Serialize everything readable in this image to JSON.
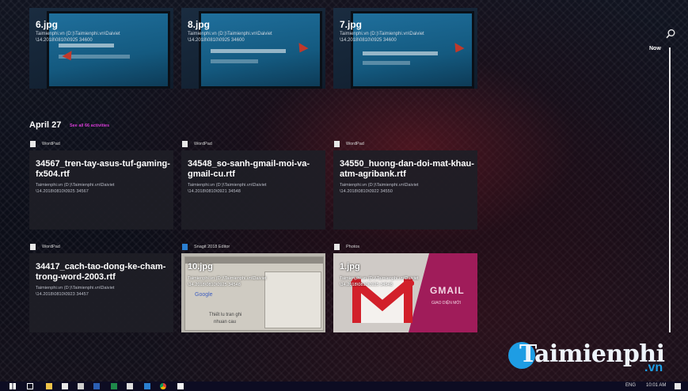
{
  "timeline_marker": "Now",
  "top_cards": [
    {
      "title": "6.jpg",
      "line1": "Taimienphi.vn (D:)\\Taimienphi.vn\\Daiviet",
      "line2": "\\14.2018\\0810\\0925 34600"
    },
    {
      "title": "8.jpg",
      "line1": "Taimienphi.vn (D:)\\Taimienphi.vn\\Daiviet",
      "line2": "\\14.2018\\0810\\0925 34600"
    },
    {
      "title": "7.jpg",
      "line1": "Taimienphi.vn (D:)\\Taimienphi.vn\\Daiviet",
      "line2": "\\14.2018\\0810\\0925 34600"
    }
  ],
  "section": {
    "date": "April 27",
    "see_all": "See all 66 activities"
  },
  "row1": [
    {
      "app": "WordPad",
      "title": "34567_tren-tay-asus-tuf-gaming-fx504.rtf",
      "line1": "Taimienphi.vn (D:)\\Taimienphi.vn\\Daiviet",
      "line2": "\\14.2018\\0810\\0925 34567"
    },
    {
      "app": "WordPad",
      "title": "34548_so-sanh-gmail-moi-va-gmail-cu.rtf",
      "line1": "Taimienphi.vn (D:)\\Taimienphi.vn\\Daiviet",
      "line2": "\\14.2018\\0810\\0921 34548"
    },
    {
      "app": "WordPad",
      "title": "34550_huong-dan-doi-mat-khau-atm-agribank.rtf",
      "line1": "Taimienphi.vn (D:)\\Taimienphi.vn\\Daiviet",
      "line2": "\\14.2018\\0810\\0922 34550"
    }
  ],
  "row2": [
    {
      "app": "WordPad",
      "title": "34417_cach-tao-dong-ke-cham-trong-word-2003.rtf",
      "line1": "Taimienphi.vn (D:)\\Taimienphi.vn\\Daiviet",
      "line2": "\\14.2018\\0810\\0923 34457"
    },
    {
      "app": "Snagit 2018 Editor",
      "title": "10.jpg",
      "line1": "Taimienphi.vn (D:)\\Taimienphi.vn\\Daiviet",
      "line2": "\\14.2018\\0810\\0925 34548",
      "thumb_text1": "Thiết lu tran ghi",
      "thumb_text2": "nhuan cau",
      "thumb_brand": "Google"
    },
    {
      "app": "Photos",
      "title": "1.jpg",
      "line1": "Taimienphi.vn (D:)\\Taimienphi.vn\\Daiviet",
      "line2": "\\14.2018\\0810\\0925 34548",
      "thumb_brand": "GMAIL",
      "thumb_sub": "GIAO DIỆN MỚI"
    }
  ],
  "watermark": {
    "brand": "Taimienphi",
    "tld": ".vn"
  },
  "taskbar": {
    "lang": "ENG",
    "time": "10:01 AM"
  },
  "colors": {
    "accent_pink": "#d63ad6",
    "brand_blue": "#1e9de4",
    "gmail_red": "#d2202a",
    "gmail_magenta": "#a01c5a"
  },
  "icons": [
    "search-icon",
    "windows-start-icon",
    "task-view-icon",
    "file-explorer-icon",
    "mail-icon",
    "store-icon",
    "word-icon",
    "excel-icon",
    "snagit-icon",
    "chrome-icon",
    "photos-icon"
  ]
}
